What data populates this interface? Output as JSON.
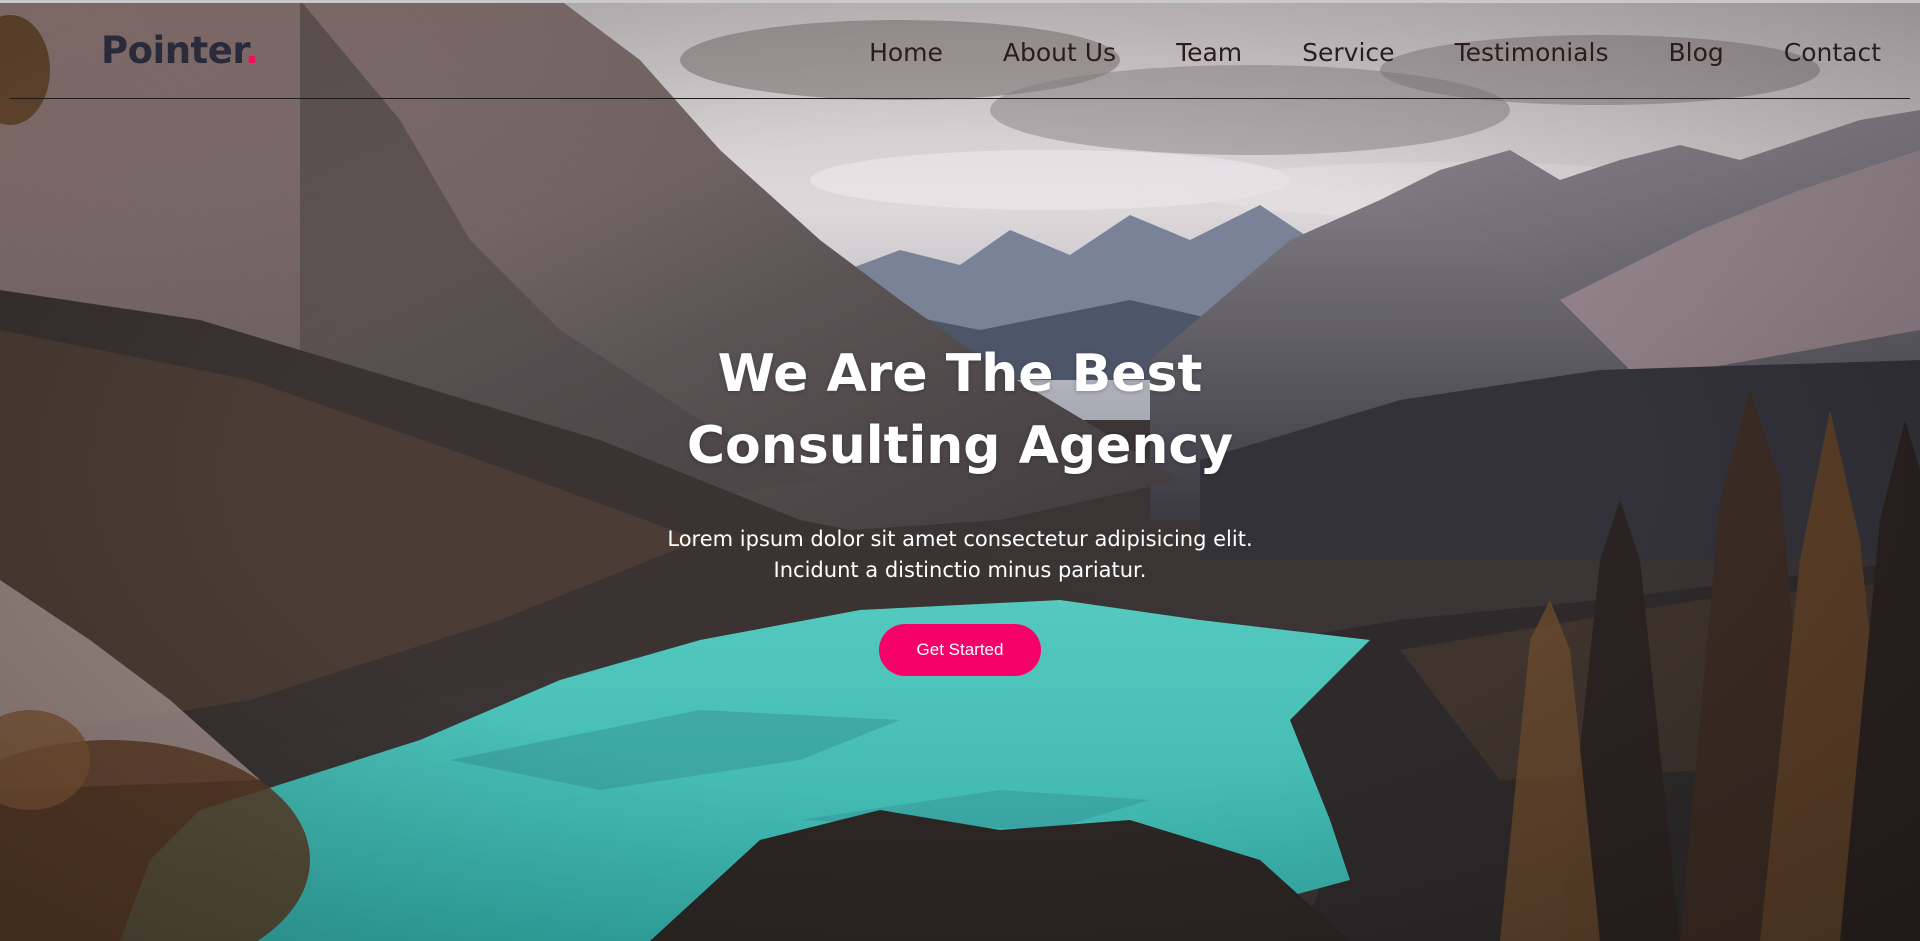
{
  "brand": {
    "name": "Pointer",
    "dot": "."
  },
  "nav": {
    "items": [
      "Home",
      "About Us",
      "Team",
      "Service",
      "Testimonials",
      "Blog",
      "Contact"
    ]
  },
  "hero": {
    "headline_line1": "We Are The Best",
    "headline_line2": "Consulting Agency",
    "subtext_line1": "Lorem ipsum dolor sit amet consectetur adipisicing elit.",
    "subtext_line2": "Incidunt a distinctio minus pariatur.",
    "cta_label": "Get Started"
  },
  "colors": {
    "accent": "#f6006a",
    "logo_dot": "#e8125f",
    "logo_text": "#2a2b3a",
    "nav_text": "#2b1c1e",
    "hero_text": "#ffffff"
  }
}
